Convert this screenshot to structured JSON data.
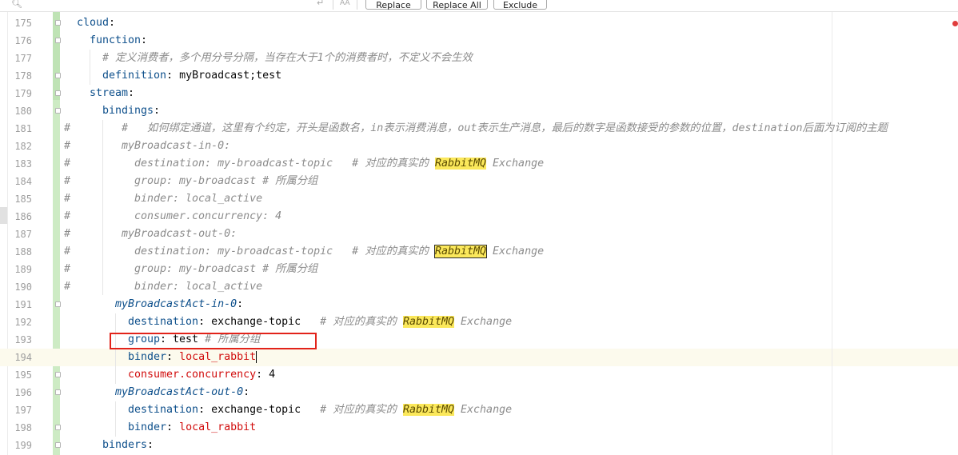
{
  "search": {
    "placeholder": "",
    "replace_label": "Replace",
    "replace_all_label": "Replace All",
    "exclude_label": "Exclude",
    "icons": [
      "search-icon",
      "enter-icon",
      "match-case-icon"
    ]
  },
  "colors": {
    "keyword": "#0d4f8b",
    "comment": "#8c8c8c",
    "highlight": "#fbe85b",
    "annotation": "#e2231a",
    "vcs_added": "#cdebc4"
  },
  "lines": [
    {
      "n": "175",
      "hash": "",
      "parts": [
        {
          "t": "cloud",
          "c": "key"
        },
        {
          "t": ":",
          "c": "plain"
        }
      ]
    },
    {
      "n": "176",
      "hash": "",
      "parts": [
        {
          "t": "function",
          "c": "key"
        },
        {
          "t": ":",
          "c": "plain"
        }
      ]
    },
    {
      "n": "177",
      "hash": "",
      "parts": [
        {
          "t": "# 定义消费者，多个用分号分隔，当存在大于1个的消费者时，不定义不会生效",
          "c": "ital"
        }
      ]
    },
    {
      "n": "178",
      "hash": "",
      "parts": [
        {
          "t": "definition",
          "c": "key"
        },
        {
          "t": ": myBroadcast;test",
          "c": "plain"
        }
      ]
    },
    {
      "n": "179",
      "hash": "",
      "parts": [
        {
          "t": "stream",
          "c": "key"
        },
        {
          "t": ":",
          "c": "plain"
        }
      ]
    },
    {
      "n": "180",
      "hash": "",
      "parts": [
        {
          "t": "bindings",
          "c": "key"
        },
        {
          "t": ":",
          "c": "plain"
        }
      ]
    },
    {
      "n": "181",
      "hash": "#",
      "parts": [
        {
          "t": "#   如何绑定通道，这里有个约定，开头是函数名，in表示消费消息，out表示生产消息，最后的数字是函数接受的参数的位置，destination后面为订阅的主题",
          "c": "ital"
        }
      ]
    },
    {
      "n": "182",
      "hash": "#",
      "parts": [
        {
          "t": "myBroadcast-in-0:",
          "c": "ital"
        }
      ]
    },
    {
      "n": "183",
      "hash": "#",
      "parts": [
        {
          "t": "destination: my-broadcast-topic   # 对应的真实的 ",
          "c": "ital"
        },
        {
          "t": "RabbitMQ",
          "c": "rabbit"
        },
        {
          "t": " Exchange",
          "c": "ital"
        }
      ]
    },
    {
      "n": "184",
      "hash": "#",
      "parts": [
        {
          "t": "group: my-broadcast # 所属分组",
          "c": "ital"
        }
      ]
    },
    {
      "n": "185",
      "hash": "#",
      "parts": [
        {
          "t": "binder: local_active",
          "c": "ital"
        }
      ]
    },
    {
      "n": "186",
      "hash": "#",
      "parts": [
        {
          "t": "consumer.concurrency: 4",
          "c": "ital"
        }
      ]
    },
    {
      "n": "187",
      "hash": "#",
      "parts": [
        {
          "t": "myBroadcast-out-0:",
          "c": "ital"
        }
      ]
    },
    {
      "n": "188",
      "hash": "#",
      "parts": [
        {
          "t": "destination: my-broadcast-topic   # 对应的真实的 ",
          "c": "ital"
        },
        {
          "t": "RabbitMQ",
          "c": "rabbit-box"
        },
        {
          "t": " Exchange",
          "c": "ital"
        }
      ]
    },
    {
      "n": "189",
      "hash": "#",
      "parts": [
        {
          "t": "group: my-broadcast # 所属分组",
          "c": "ital"
        }
      ]
    },
    {
      "n": "190",
      "hash": "#",
      "parts": [
        {
          "t": "binder: local_active",
          "c": "ital"
        }
      ]
    },
    {
      "n": "191",
      "hash": "",
      "parts": [
        {
          "t": "myBroadcastAct-in-0",
          "c": "ital-key"
        },
        {
          "t": ":",
          "c": "plain"
        }
      ]
    },
    {
      "n": "192",
      "hash": "",
      "parts": [
        {
          "t": "destination",
          "c": "key"
        },
        {
          "t": ": exchange-topic   ",
          "c": "plain"
        },
        {
          "t": "# 对应的真实的 ",
          "c": "ital"
        },
        {
          "t": "RabbitMQ",
          "c": "rabbit"
        },
        {
          "t": " Exchange",
          "c": "ital"
        }
      ]
    },
    {
      "n": "193",
      "hash": "",
      "parts": [
        {
          "t": "group",
          "c": "key"
        },
        {
          "t": ": test ",
          "c": "plain"
        },
        {
          "t": "# 所属分组",
          "c": "ital"
        }
      ]
    },
    {
      "n": "194",
      "hash": "",
      "parts": [
        {
          "t": "binder",
          "c": "key"
        },
        {
          "t": ": ",
          "c": "plain"
        },
        {
          "t": "local_rabbit",
          "c": "red caret"
        }
      ]
    },
    {
      "n": "195",
      "hash": "",
      "parts": [
        {
          "t": "consumer.concurrency",
          "c": "red"
        },
        {
          "t": ": 4",
          "c": "plain"
        }
      ]
    },
    {
      "n": "196",
      "hash": "",
      "parts": [
        {
          "t": "myBroadcastAct-out-0",
          "c": "ital-key"
        },
        {
          "t": ":",
          "c": "plain"
        }
      ]
    },
    {
      "n": "197",
      "hash": "",
      "parts": [
        {
          "t": "destination",
          "c": "key"
        },
        {
          "t": ": exchange-topic   ",
          "c": "plain"
        },
        {
          "t": "# 对应的真实的 ",
          "c": "ital"
        },
        {
          "t": "RabbitMQ",
          "c": "rabbit"
        },
        {
          "t": " Exchange",
          "c": "ital"
        }
      ]
    },
    {
      "n": "198",
      "hash": "",
      "parts": [
        {
          "t": "binder",
          "c": "key"
        },
        {
          "t": ": ",
          "c": "plain"
        },
        {
          "t": "local_rabbit",
          "c": "red"
        }
      ]
    },
    {
      "n": "199",
      "hash": "",
      "parts": [
        {
          "t": "binders",
          "c": "key"
        },
        {
          "t": ":",
          "c": "plain"
        }
      ]
    }
  ]
}
